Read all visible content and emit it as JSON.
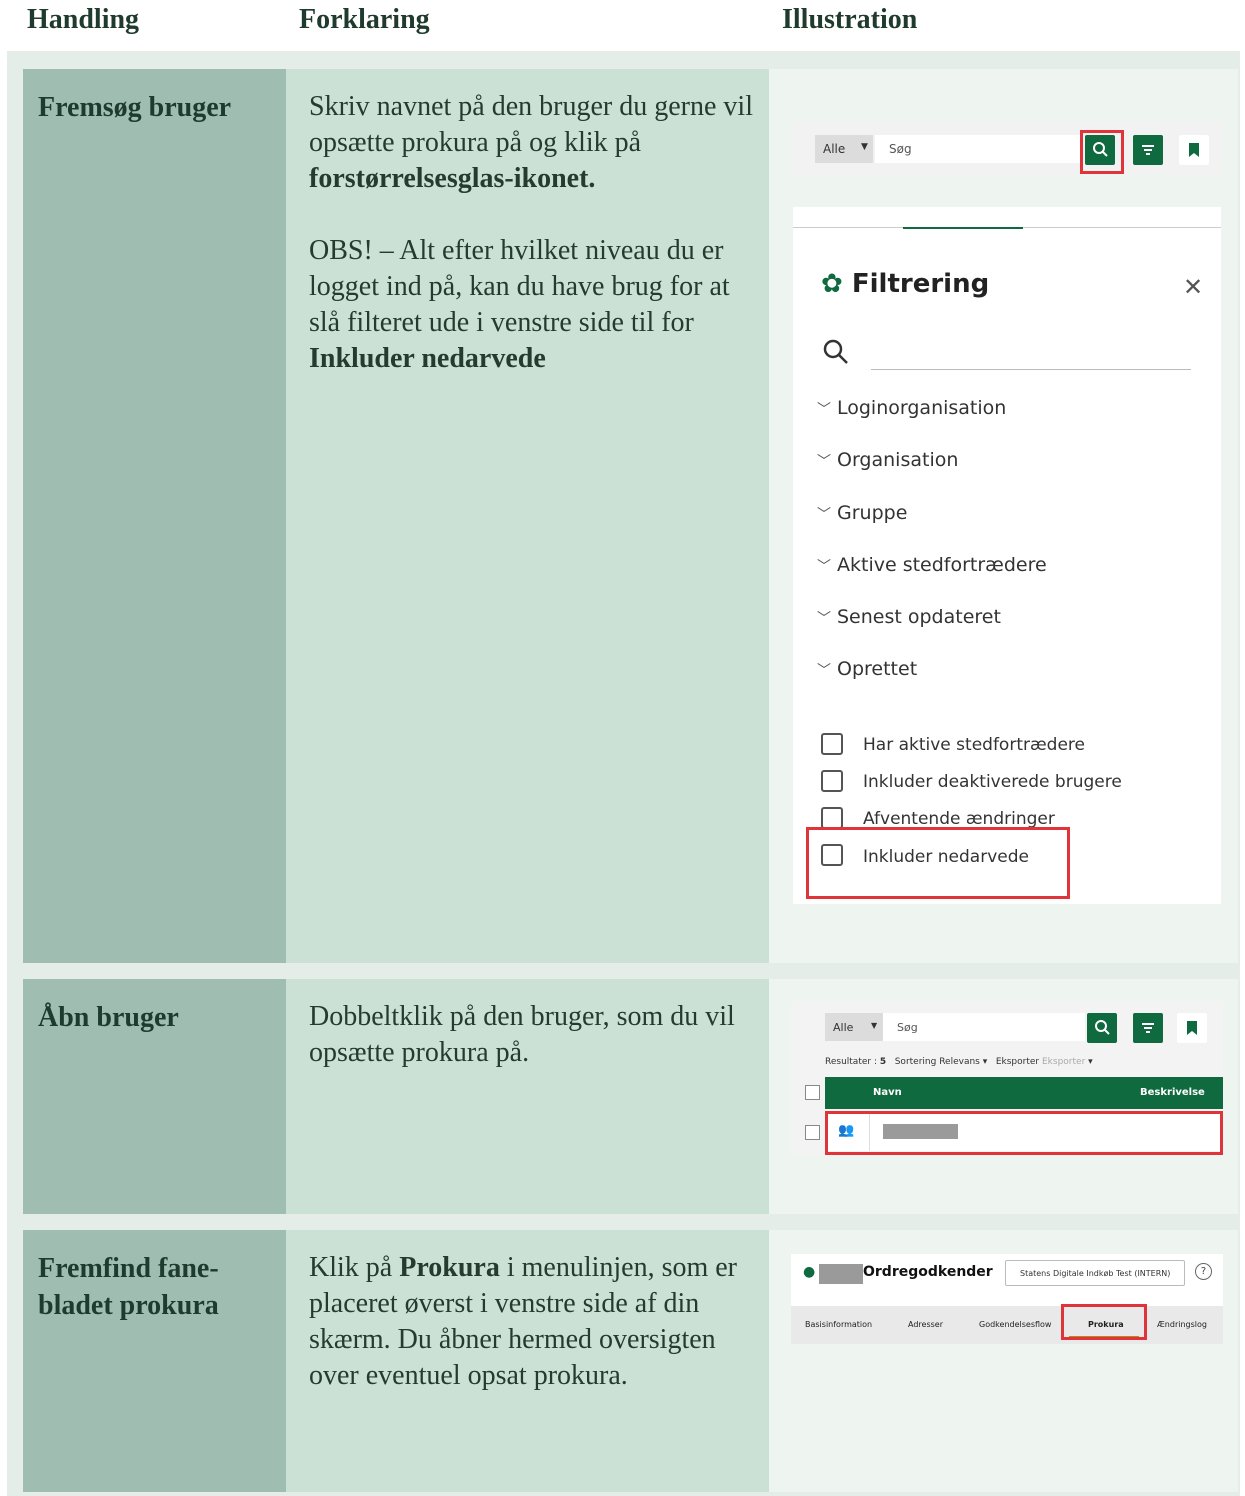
{
  "header": {
    "col1": "Handling",
    "col2": "Forklaring",
    "col3": "Illustration"
  },
  "rows": [
    {
      "action": "Fremsøg bruger",
      "expl_p1_pre": "Skriv navnet på den bruger du gerne vil opsætte prokura på og klik på ",
      "expl_p1_bold": "forstørrelsesglas-ikonet.",
      "expl_p2_pre": "OBS! – Alt efter hvilket niveau du er logget ind på, kan du have brug for at slå filteret ude i venstre side til for ",
      "expl_p2_bold": "Inkluder nedarvede",
      "illustration": {
        "search_scope": "Alle",
        "search_placeholder": "Søg",
        "filter_title": "Filtrering",
        "filter_sections": [
          "Loginorganisation",
          "Organisation",
          "Gruppe",
          "Aktive stedfortrædere",
          "Senest opdateret",
          "Oprettet"
        ],
        "checkboxes": [
          "Har aktive stedfortrædere",
          "Inkluder deaktiverede brugere",
          "Afventende ændringer",
          "Inkluder nedarvede"
        ]
      }
    },
    {
      "action": "Åbn bruger",
      "expl_pre": "Dobbeltklik på den bruger, som du vil opsætte prokura på.",
      "illustration": {
        "search_scope": "Alle",
        "search_placeholder": "Søg",
        "results_label": "Resultater :",
        "results_count": "5",
        "sort_label": "Sortering",
        "sort_value": "Relevans",
        "export_label": "Eksporter",
        "export_value": "Eksporter",
        "col_name": "Navn",
        "col_desc": "Beskrivelse"
      }
    },
    {
      "action": "Fremfind fane-bladet prokura",
      "expl_pre": "Klik på ",
      "expl_bold": "Prokura",
      "expl_post": " i menulinjen, som er placeret øverst i venstre side af din skærm. Du åbner hermed oversigten over eventuel opsat prokura.",
      "illustration": {
        "role": "Ordregodkender",
        "org": "Statens Digitale Indkøb Test (INTERN)",
        "help": "?",
        "tabs": [
          "Basisinformation",
          "Adresser",
          "Godkendelsesflow",
          "Prokura",
          "Ændringslog"
        ]
      }
    }
  ],
  "colors": {
    "green": "#0f6b3f",
    "highlight": "#e0343b",
    "tab_underline": "#b58a16"
  }
}
